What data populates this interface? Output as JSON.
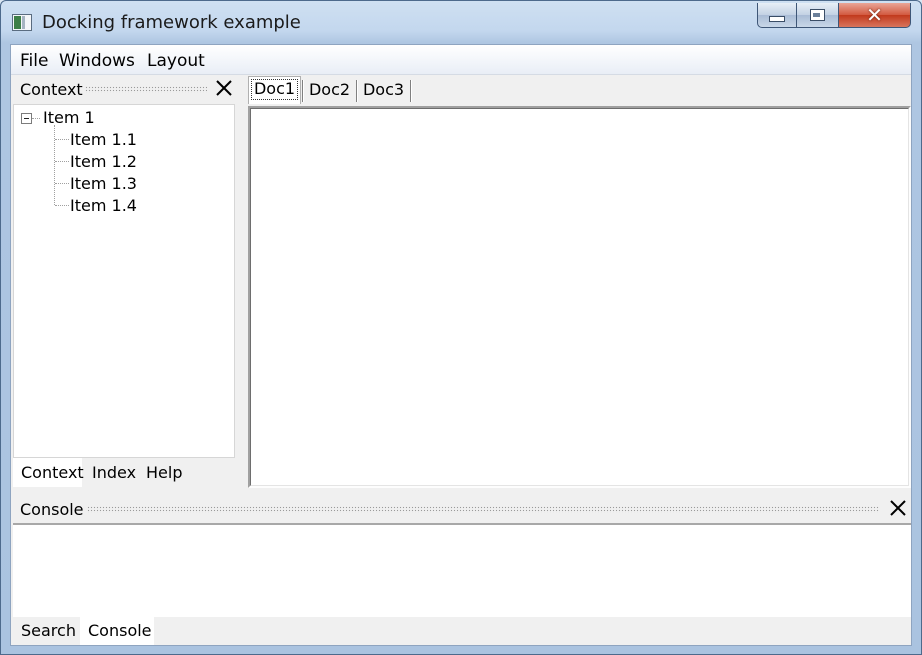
{
  "window": {
    "title": "Docking framework example",
    "controls": {
      "minimize": "minimize",
      "maximize": "maximize",
      "close": "close"
    }
  },
  "menubar": {
    "items": [
      "File",
      "Windows",
      "Layout"
    ]
  },
  "context_panel": {
    "title": "Context",
    "tree": {
      "root": "Item 1",
      "children": [
        "Item 1.1",
        "Item 1.2",
        "Item 1.3",
        "Item 1.4"
      ]
    },
    "tabs": [
      "Context",
      "Index",
      "Help"
    ],
    "active_tab": "Context"
  },
  "documents": {
    "tabs": [
      "Doc1",
      "Doc2",
      "Doc3"
    ],
    "active_tab": "Doc1"
  },
  "console_panel": {
    "title": "Console",
    "tabs": [
      "Search",
      "Console"
    ],
    "active_tab": "Console"
  },
  "colors": {
    "frame": "#aac3e0",
    "client_bg": "#f0f0f0",
    "close_button": "#c23a1d"
  },
  "icons": {
    "app": "app-window-icon",
    "panel_close": "close-x-icon",
    "tree_expander": "minus-box-icon"
  }
}
